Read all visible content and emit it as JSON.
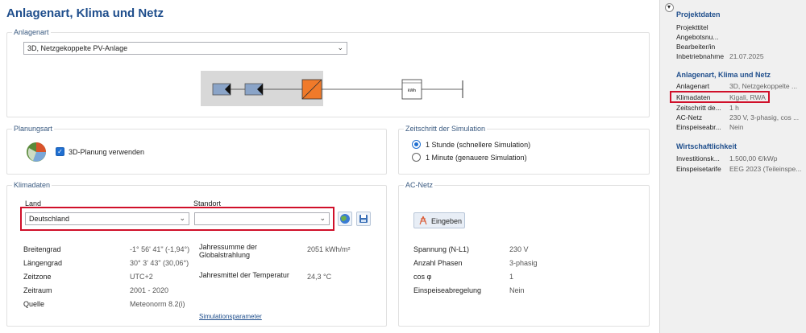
{
  "page_title": "Anlagenart, Klima und Netz",
  "anlagenart": {
    "title": "Anlagenart",
    "selected": "3D, Netzgekoppelte PV-Anlage",
    "diagram_label": "kWh"
  },
  "planungsart": {
    "title": "Planungsart",
    "checkbox_label": "3D-Planung verwenden"
  },
  "zeitschritt": {
    "title": "Zeitschritt der Simulation",
    "options": [
      "1 Stunde (schnellere Simulation)",
      "1 Minute (genauere Simulation)"
    ],
    "selected_index": 0
  },
  "klimadaten": {
    "title": "Klimadaten",
    "land_label": "Land",
    "land_value": "Deutschland",
    "standort_label": "Standort",
    "standort_value": "",
    "rows_left": [
      {
        "label": "Breitengrad",
        "value": "-1° 56' 41\" (-1,94°)"
      },
      {
        "label": "Längengrad",
        "value": "30° 3' 43\" (30,06°)"
      },
      {
        "label": "Zeitzone",
        "value": "UTC+2"
      },
      {
        "label": "Zeitraum",
        "value": "2001 - 2020"
      },
      {
        "label": "Quelle",
        "value": "Meteonorm 8.2(i)"
      }
    ],
    "jahressumme_label_1": "Jahressumme der",
    "jahressumme_label_2": "Globalstrahlung",
    "jahressumme_value": "2051 kWh/m²",
    "jahresmittel_label": "Jahresmittel der Temperatur",
    "jahresmittel_value": "24,3 °C",
    "link": "Simulationsparameter"
  },
  "acnetz": {
    "title": "AC-Netz",
    "button": "Eingeben",
    "rows": [
      {
        "label": "Spannung (N-L1)",
        "value": "230 V"
      },
      {
        "label": "Anzahl Phasen",
        "value": "3-phasig"
      },
      {
        "label": "cos φ",
        "value": "1"
      },
      {
        "label": "Einspeiseabregelung",
        "value": "Nein"
      }
    ]
  },
  "sidebar": {
    "sections": [
      {
        "title": "Projektdaten",
        "rows": [
          {
            "label": "Projekttitel",
            "value": ""
          },
          {
            "label": "Angebotsnu...",
            "value": ""
          },
          {
            "label": "Bearbeiter/in",
            "value": ""
          },
          {
            "label": "Inbetriebnahme",
            "value": "21.07.2025"
          }
        ]
      },
      {
        "title": "Anlagenart, Klima und Netz",
        "rows": [
          {
            "label": "Anlagenart",
            "value": "3D, Netzgekoppelte ..."
          },
          {
            "label": "Klimadaten",
            "value": "Kigali, RWA"
          },
          {
            "label": "Zeitschritt de...",
            "value": "1 h"
          },
          {
            "label": "AC-Netz",
            "value": "230 V, 3-phasig, cos ..."
          },
          {
            "label": "Einspeiseabr...",
            "value": "Nein"
          }
        ]
      },
      {
        "title": "Wirtschaftlichkeit",
        "rows": [
          {
            "label": "Investitionsk...",
            "value": "1.500,00 €/kWp"
          },
          {
            "label": "Einspeisetarife",
            "value": "EEG 2023 (Teileinspe..."
          }
        ]
      }
    ]
  },
  "colors": {
    "title_blue": "#1f4e8c",
    "highlight_red": "#d0102a",
    "accent_blue": "#1f6fd1",
    "diagram_orange": "#f07a2a",
    "diagram_module": "#8aa4c8"
  }
}
